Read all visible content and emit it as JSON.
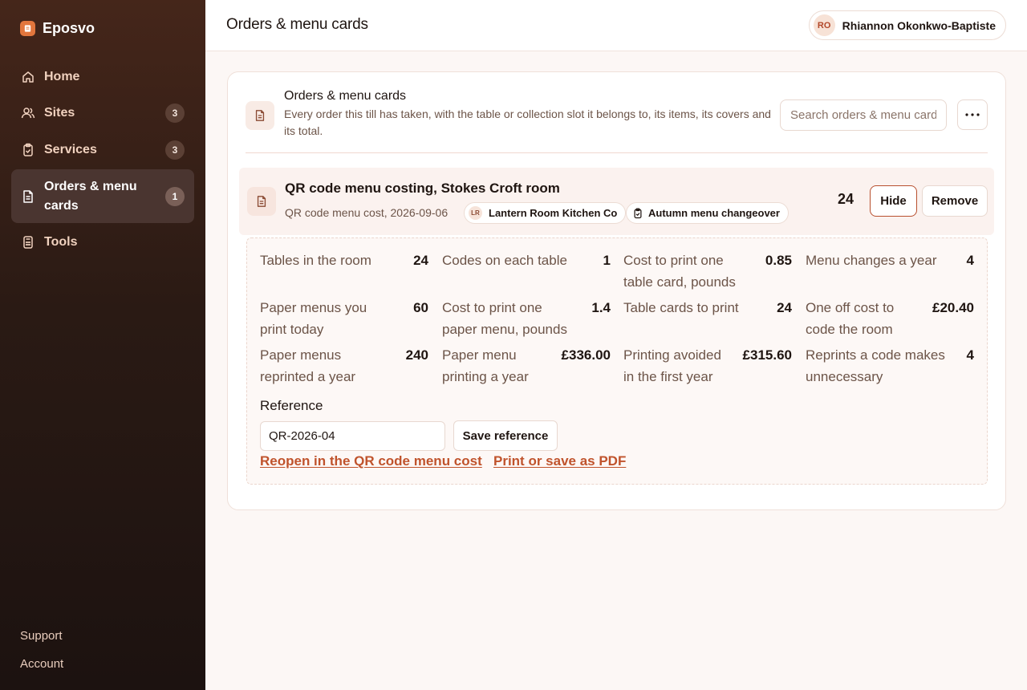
{
  "brand": {
    "name": "Eposvo"
  },
  "sidebar": {
    "items": [
      {
        "label": "Home",
        "icon": "home-icon",
        "badge": ""
      },
      {
        "label": "Sites",
        "icon": "users-icon",
        "badge": "3"
      },
      {
        "label": "Services",
        "icon": "clipboard-icon",
        "badge": "3"
      },
      {
        "label": "Orders & menu cards",
        "icon": "document-icon",
        "badge": "1",
        "active": true
      },
      {
        "label": "Tools",
        "icon": "calculator-icon",
        "badge": ""
      }
    ],
    "footer": {
      "support": "Support",
      "account": "Account"
    }
  },
  "header": {
    "title": "Orders & menu cards",
    "user": {
      "initials": "RO",
      "name": "Rhiannon Okonkwo-Baptiste"
    }
  },
  "card": {
    "title": "Orders & menu cards",
    "description": "Every order this till has taken, with the table or collection slot it belongs to, its items, its covers and its total.",
    "search_placeholder": "Search orders & menu cards",
    "entry": {
      "title": "QR code menu costing, Stokes Croft room",
      "subtitle": "QR code menu cost, 2026-09-06",
      "site_chip": {
        "initials": "LR",
        "label": "Lantern Room Kitchen Co"
      },
      "service_chip": {
        "label": "Autumn menu changeover"
      },
      "count": "24",
      "hide_label": "Hide",
      "remove_label": "Remove"
    },
    "metrics": [
      {
        "label": "Tables in the room",
        "value": "24"
      },
      {
        "label": "Codes on each table",
        "value": "1"
      },
      {
        "label": "Cost to print one table card, pounds",
        "value": "0.85"
      },
      {
        "label": "Menu changes a year",
        "value": "4"
      },
      {
        "label": "Paper menus you print today",
        "value": "60"
      },
      {
        "label": "Cost to print one paper menu, pounds",
        "value": "1.4"
      },
      {
        "label": "Table cards to print",
        "value": "24"
      },
      {
        "label": "One off cost to code the room",
        "value": "£20.40"
      },
      {
        "label": "Paper menus reprinted a year",
        "value": "240"
      },
      {
        "label": "Paper menu printing a year",
        "value": "£336.00"
      },
      {
        "label": "Printing avoided in the first year",
        "value": "£315.60"
      },
      {
        "label": "Reprints a code makes unnecessary",
        "value": "4"
      }
    ],
    "reference": {
      "label": "Reference",
      "value": "QR-2026-04",
      "save_label": "Save reference"
    },
    "links": {
      "reopen": "Reopen in the QR code menu cost",
      "print": "Print or save as PDF"
    }
  },
  "colors": {
    "accent": "#c0532c",
    "sidebar_top": "#45261a",
    "sidebar_bottom": "#1c1210"
  }
}
